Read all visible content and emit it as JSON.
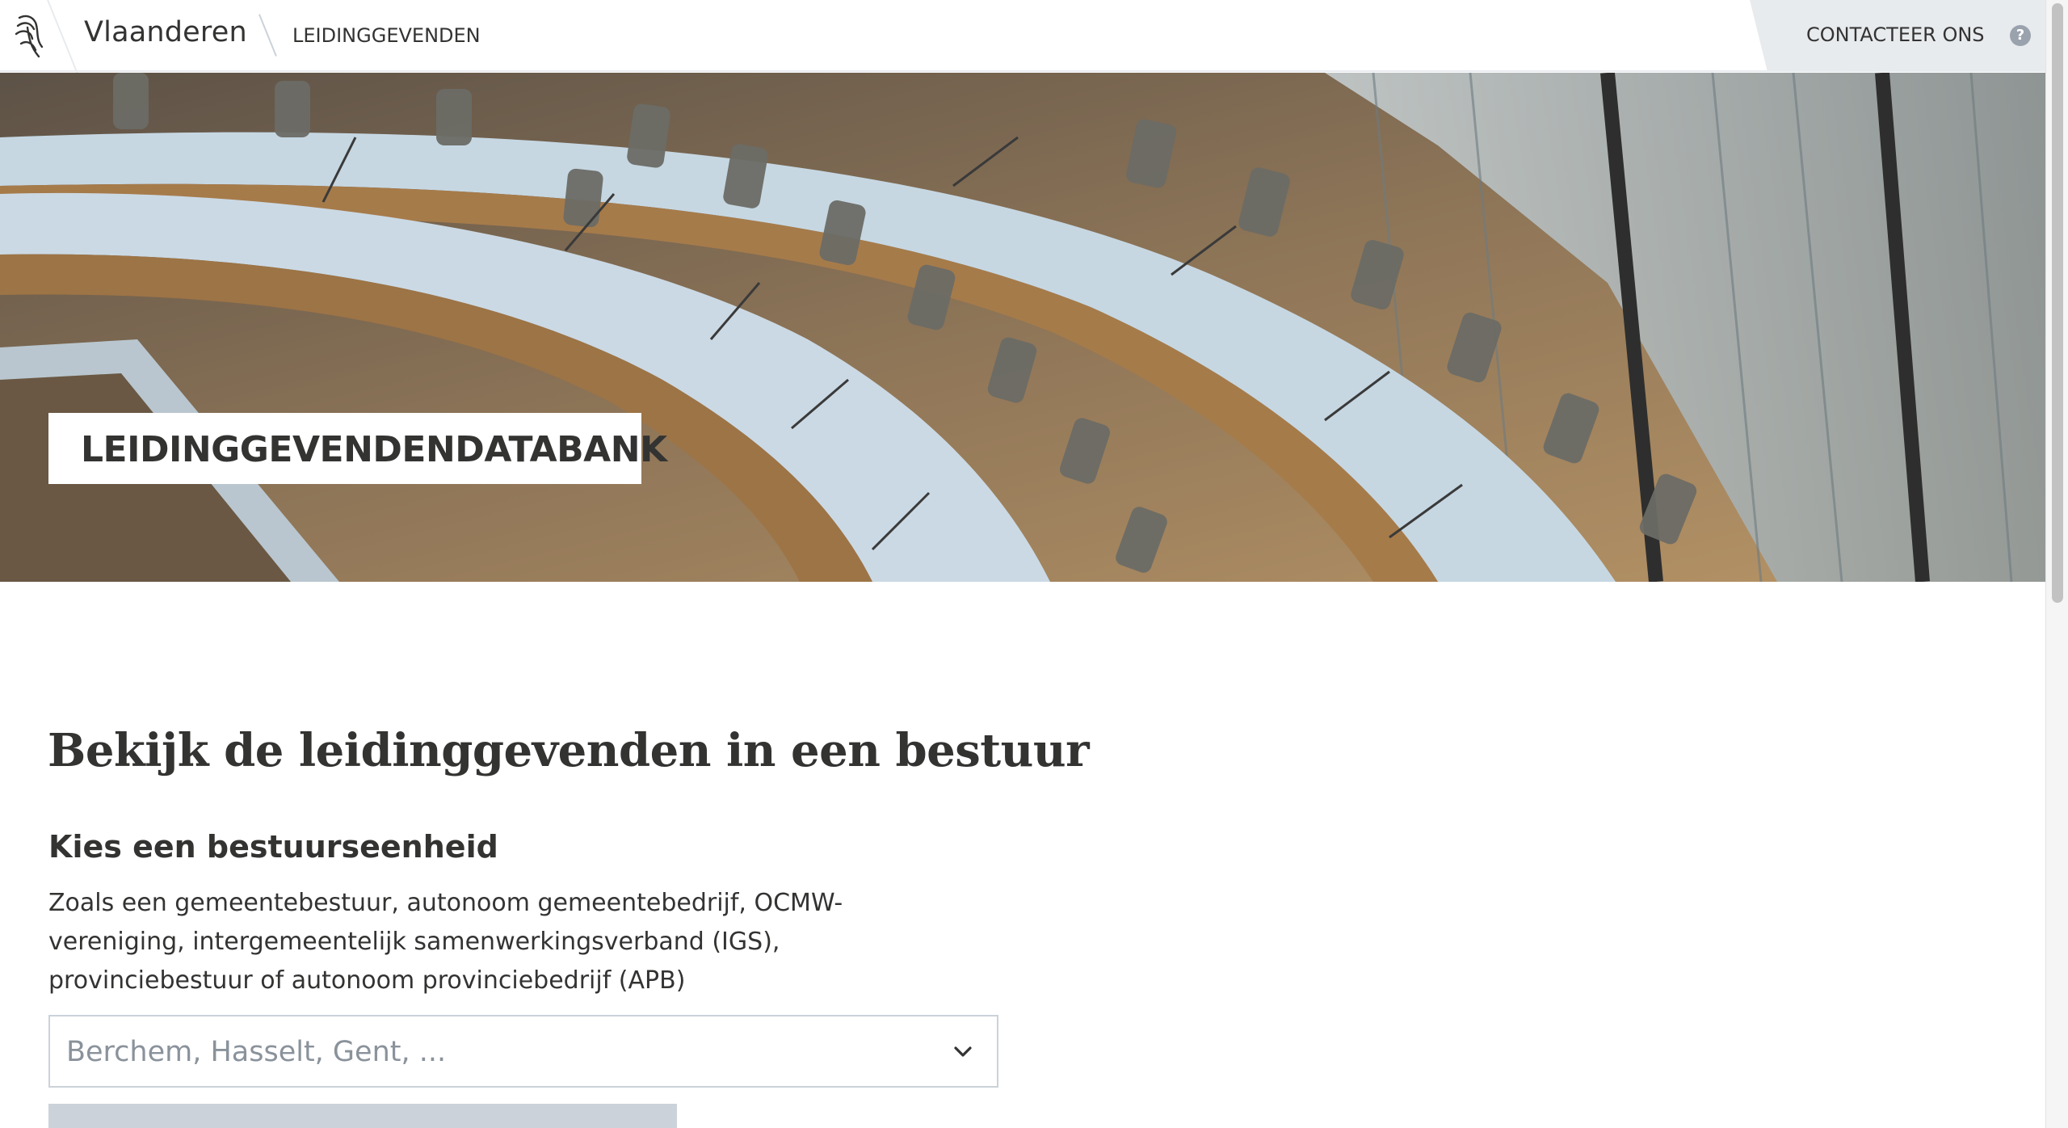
{
  "header": {
    "brand": "Vlaanderen",
    "breadcrumb": "LEIDINGGEVENDEN",
    "contact_label": "CONTACTEER ONS",
    "help_glyph": "?",
    "logo_icon": "flemish-lion-icon"
  },
  "hero": {
    "title": "LEIDINGGEVENDENDATABANK",
    "image_subject": "council-chamber-photo"
  },
  "main": {
    "heading": "Bekijk de leidinggevenden in een bestuur",
    "subheading": "Kies een bestuurseenheid",
    "description": "Zoals een gemeentebestuur, autonoom gemeentebedrijf, OCMW-vereniging, intergemeentelijk samenwerkingsverband (IGS), provinciebestuur of autonoom provinciebedrijf (APB)",
    "select": {
      "placeholder": "Berchem, Hasselt, Gent, ...",
      "icon": "chevron-down-icon"
    }
  },
  "colors": {
    "text": "#333332",
    "border": "#cbd2da",
    "contact_bg": "#e8ebee",
    "placeholder": "#8a929b"
  }
}
